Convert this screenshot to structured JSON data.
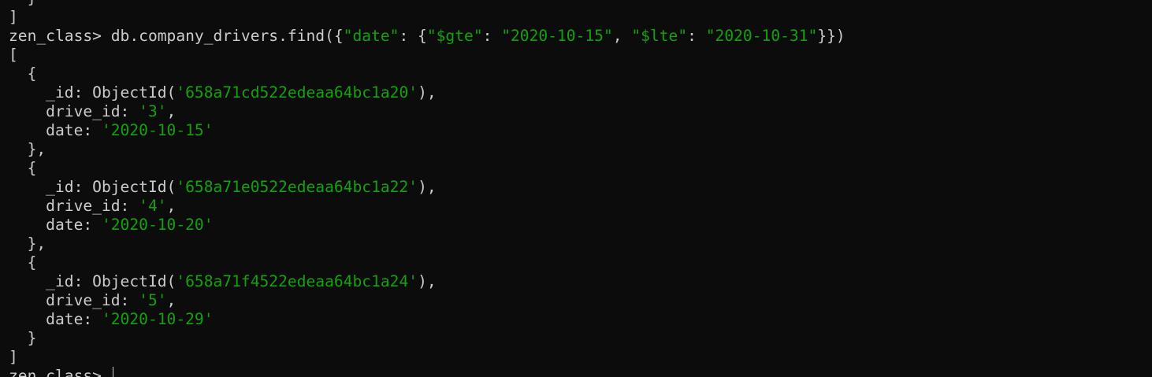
{
  "colors": {
    "background": "#0c0c0c",
    "text": "#cccccc",
    "string": "#13a10e"
  },
  "lines": [
    [
      {
        "t": "  }",
        "c": "txt"
      }
    ],
    [
      {
        "t": "]",
        "c": "txt"
      }
    ],
    [
      {
        "t": "zen_class> db.company_drivers.find({",
        "c": "txt"
      },
      {
        "t": "\"date\"",
        "c": "str"
      },
      {
        "t": ": {",
        "c": "txt"
      },
      {
        "t": "\"$gte\"",
        "c": "str"
      },
      {
        "t": ": ",
        "c": "txt"
      },
      {
        "t": "\"2020-10-15\"",
        "c": "str"
      },
      {
        "t": ", ",
        "c": "txt"
      },
      {
        "t": "\"$lte\"",
        "c": "str"
      },
      {
        "t": ": ",
        "c": "txt"
      },
      {
        "t": "\"2020-10-31\"",
        "c": "str"
      },
      {
        "t": "}})",
        "c": "txt"
      }
    ],
    [
      {
        "t": "[",
        "c": "txt"
      }
    ],
    [
      {
        "t": "  {",
        "c": "txt"
      }
    ],
    [
      {
        "t": "    _id: ObjectId(",
        "c": "txt"
      },
      {
        "t": "'658a71cd522edeaa64bc1a20'",
        "c": "str"
      },
      {
        "t": "),",
        "c": "txt"
      }
    ],
    [
      {
        "t": "    drive_id: ",
        "c": "txt"
      },
      {
        "t": "'3'",
        "c": "str"
      },
      {
        "t": ",",
        "c": "txt"
      }
    ],
    [
      {
        "t": "    date: ",
        "c": "txt"
      },
      {
        "t": "'2020-10-15'",
        "c": "str"
      }
    ],
    [
      {
        "t": "  },",
        "c": "txt"
      }
    ],
    [
      {
        "t": "  {",
        "c": "txt"
      }
    ],
    [
      {
        "t": "    _id: ObjectId(",
        "c": "txt"
      },
      {
        "t": "'658a71e0522edeaa64bc1a22'",
        "c": "str"
      },
      {
        "t": "),",
        "c": "txt"
      }
    ],
    [
      {
        "t": "    drive_id: ",
        "c": "txt"
      },
      {
        "t": "'4'",
        "c": "str"
      },
      {
        "t": ",",
        "c": "txt"
      }
    ],
    [
      {
        "t": "    date: ",
        "c": "txt"
      },
      {
        "t": "'2020-10-20'",
        "c": "str"
      }
    ],
    [
      {
        "t": "  },",
        "c": "txt"
      }
    ],
    [
      {
        "t": "  {",
        "c": "txt"
      }
    ],
    [
      {
        "t": "    _id: ObjectId(",
        "c": "txt"
      },
      {
        "t": "'658a71f4522edeaa64bc1a24'",
        "c": "str"
      },
      {
        "t": "),",
        "c": "txt"
      }
    ],
    [
      {
        "t": "    drive_id: ",
        "c": "txt"
      },
      {
        "t": "'5'",
        "c": "str"
      },
      {
        "t": ",",
        "c": "txt"
      }
    ],
    [
      {
        "t": "    date: ",
        "c": "txt"
      },
      {
        "t": "'2020-10-29'",
        "c": "str"
      }
    ],
    [
      {
        "t": "  }",
        "c": "txt"
      }
    ],
    [
      {
        "t": "]",
        "c": "txt"
      }
    ]
  ],
  "prompt": "zen_class> "
}
